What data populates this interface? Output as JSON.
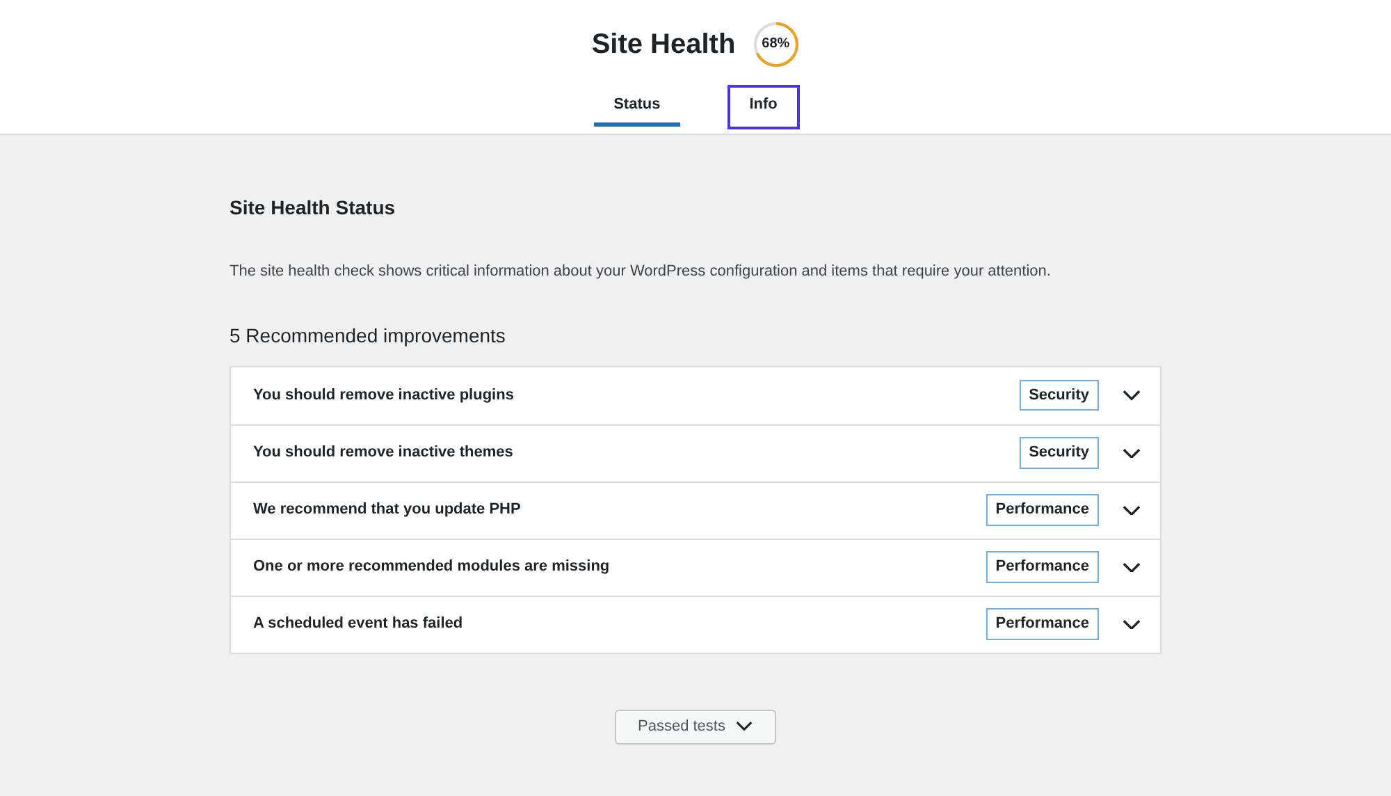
{
  "header": {
    "title": "Site Health",
    "score": {
      "text": "68%"
    }
  },
  "tabs": [
    {
      "label": "Status",
      "selected": true,
      "focused": false
    },
    {
      "label": "Info",
      "selected": false,
      "focused": true
    }
  ],
  "status": {
    "heading": "Site Health Status",
    "description": "The site health check shows critical information about your WordPress configuration and items that require your attention.",
    "improvements_heading": "5 Recommended improvements",
    "items": [
      {
        "title": "You should remove inactive plugins",
        "badge": "Security",
        "expanded": false
      },
      {
        "title": "You should remove inactive themes",
        "badge": "Security",
        "expanded": false
      },
      {
        "title": "We recommend that you update PHP",
        "badge": "Performance",
        "expanded": false
      },
      {
        "title": "One or more recommended modules are missing",
        "badge": "Performance",
        "expanded": false
      },
      {
        "title": "A scheduled event has failed",
        "badge": "Performance",
        "expanded": false
      }
    ]
  },
  "passed_tests": {
    "label": "Passed tests",
    "expanded": false
  }
}
